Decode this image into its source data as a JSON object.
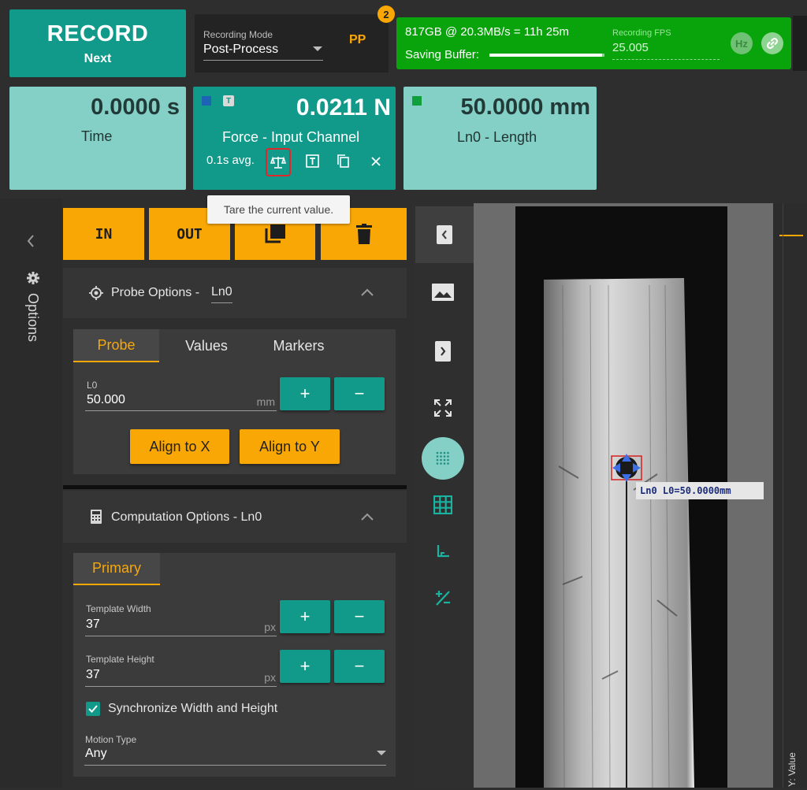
{
  "header": {
    "record_label": "RECORD",
    "record_sub": "Next",
    "recording_mode_label": "Recording Mode",
    "recording_mode_value": "Post-Process",
    "pp_label": "PP",
    "badge_count": "2",
    "status_line": "817GB @ 20.3MB/s = 11h 25m",
    "saving_buffer_label": "Saving Buffer:",
    "saving_buffer_fraction": 0.98,
    "fps_label": "Recording FPS",
    "fps_value": "25.005",
    "hz_label": "Hz"
  },
  "tiles": {
    "time": {
      "value": "0.0000 s",
      "label": "Time"
    },
    "force": {
      "value": "0.0211 N",
      "label": "Force -  Input Channel",
      "avg": "0.1s avg.",
      "small_badge": "T",
      "color": "#1e64b4"
    },
    "length": {
      "value": "50.0000 mm",
      "label": "Ln0 -  Length",
      "color": "#0fa03c"
    }
  },
  "tooltip": "Tare the current value.",
  "sidebar": {
    "label": "Options"
  },
  "toolbar": {
    "in_label": "IN",
    "out_label": "OUT"
  },
  "probe": {
    "title_prefix": "Probe Options - ",
    "title_item": "Ln0",
    "tabs": [
      "Probe",
      "Values",
      "Markers"
    ],
    "l0_label": "L0",
    "l0_value": "50.000",
    "l0_unit": "mm",
    "plus": "+",
    "minus": "−",
    "align_x": "Align to X",
    "align_y": "Align to Y"
  },
  "computation": {
    "title": "Computation Options - Ln0",
    "tab": "Primary",
    "tw_label": "Template Width",
    "tw_value": "37",
    "th_label": "Template Height",
    "th_value": "37",
    "unit": "px",
    "sync_label": "Synchronize Width and Height",
    "motion_label": "Motion Type",
    "motion_value": "Any"
  },
  "image": {
    "annotation": "Ln0 L0=50.0000mm",
    "axis_label": "Y: Value"
  },
  "colors": {
    "teal": "#11998a",
    "mint": "#84cfc6",
    "amber": "#f9a705",
    "green": "#09a40b"
  }
}
